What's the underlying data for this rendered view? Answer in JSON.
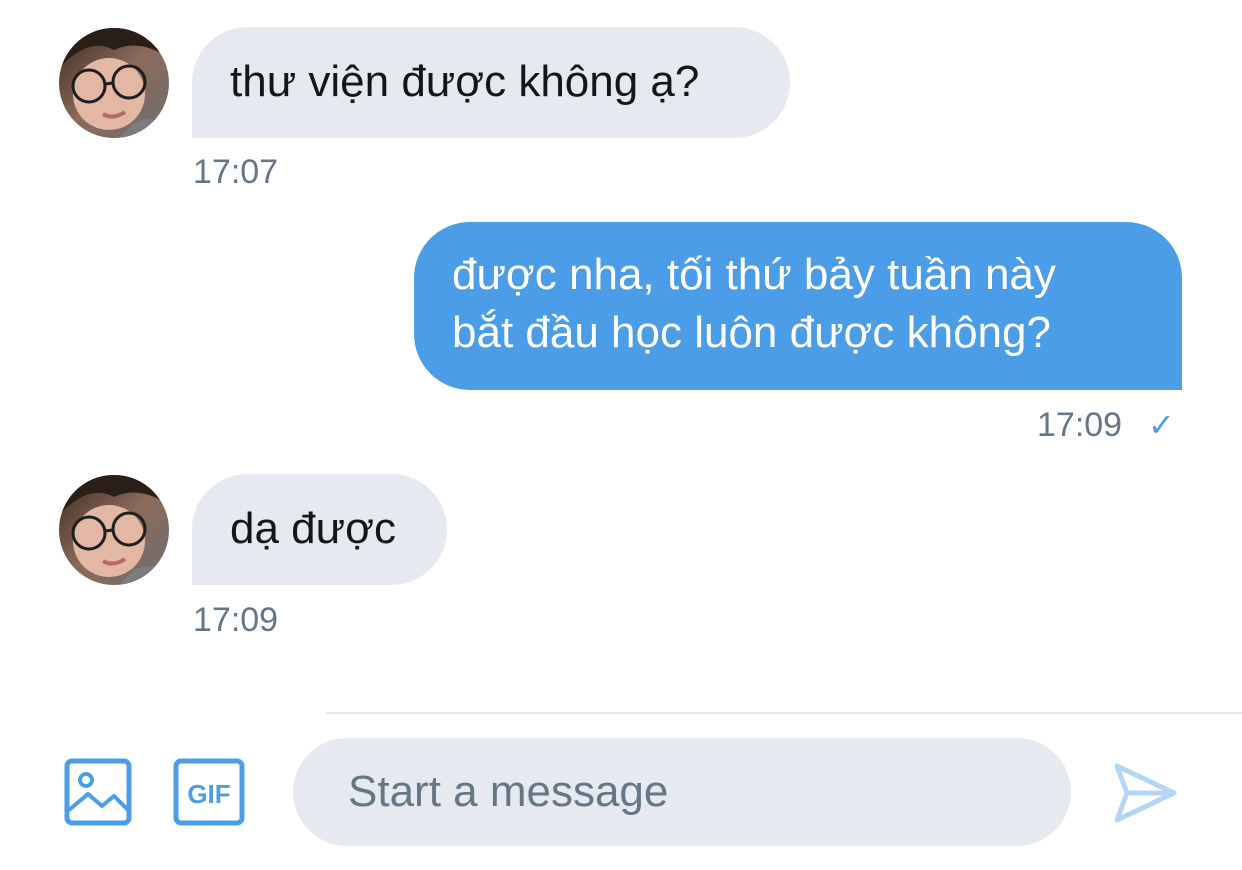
{
  "conversation": {
    "messages": [
      {
        "direction": "incoming",
        "text": "thư viện được không ạ?",
        "time": "17:07"
      },
      {
        "direction": "outgoing",
        "lines": [
          "được nha, tối thứ bảy tuần này",
          "bắt đầu học luôn được không?"
        ],
        "time": "17:09",
        "read_check": "✓"
      },
      {
        "direction": "incoming",
        "text": "dạ được",
        "time": "17:09"
      }
    ]
  },
  "composer": {
    "placeholder": "Start a message",
    "gif_label": "GIF",
    "icons": [
      "image-icon",
      "gif-icon",
      "send-icon"
    ]
  },
  "colors": {
    "accent": "#4b9de7",
    "incoming_bubble": "#e6e9ef",
    "timestamp": "#657786",
    "send_disabled": "#b3d6f5"
  }
}
